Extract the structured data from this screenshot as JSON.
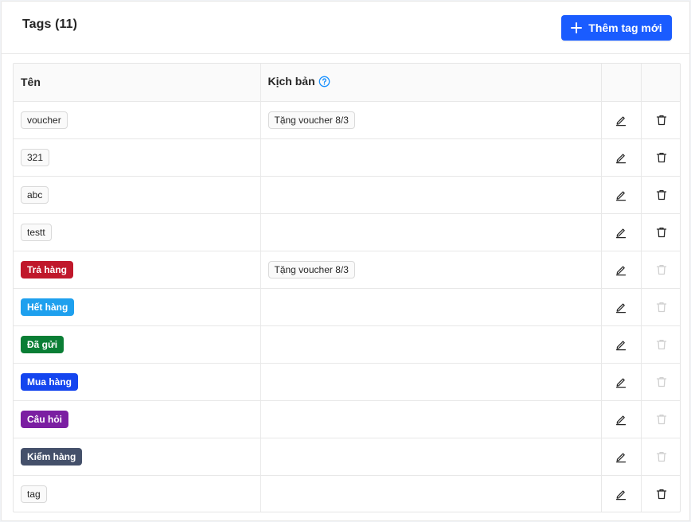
{
  "header": {
    "title": "Tags (11)",
    "add_button_label": "Thêm tag mới"
  },
  "table": {
    "columns": {
      "name": "Tên",
      "script": "Kịch bản"
    },
    "rows": [
      {
        "name": "voucher",
        "color": null,
        "script": "Tặng voucher 8/3",
        "delete_enabled": true
      },
      {
        "name": "321",
        "color": null,
        "script": "",
        "delete_enabled": true
      },
      {
        "name": "abc",
        "color": null,
        "script": "",
        "delete_enabled": true
      },
      {
        "name": "testt",
        "color": null,
        "script": "",
        "delete_enabled": true
      },
      {
        "name": "Trả hàng",
        "color": "#c0182b",
        "script": "Tặng voucher 8/3",
        "delete_enabled": false
      },
      {
        "name": "Hết hàng",
        "color": "#1ea0ee",
        "script": "",
        "delete_enabled": false
      },
      {
        "name": "Đã gửi",
        "color": "#0a7e35",
        "script": "",
        "delete_enabled": false
      },
      {
        "name": "Mua hàng",
        "color": "#1445ef",
        "script": "",
        "delete_enabled": false
      },
      {
        "name": "Câu hỏi",
        "color": "#7b1fa2",
        "script": "",
        "delete_enabled": false
      },
      {
        "name": "Kiểm hàng",
        "color": "#44506a",
        "script": "",
        "delete_enabled": false
      },
      {
        "name": "tag",
        "color": null,
        "script": "",
        "delete_enabled": true
      }
    ]
  },
  "icons": {
    "add": "plus-icon",
    "help": "question-circle-icon",
    "edit": "pencil-icon",
    "delete": "trash-icon"
  },
  "colors": {
    "primary": "#1a5cff",
    "help_icon": "#1890ff",
    "icon_enabled": "#262626",
    "icon_disabled": "#d0d0d0"
  }
}
